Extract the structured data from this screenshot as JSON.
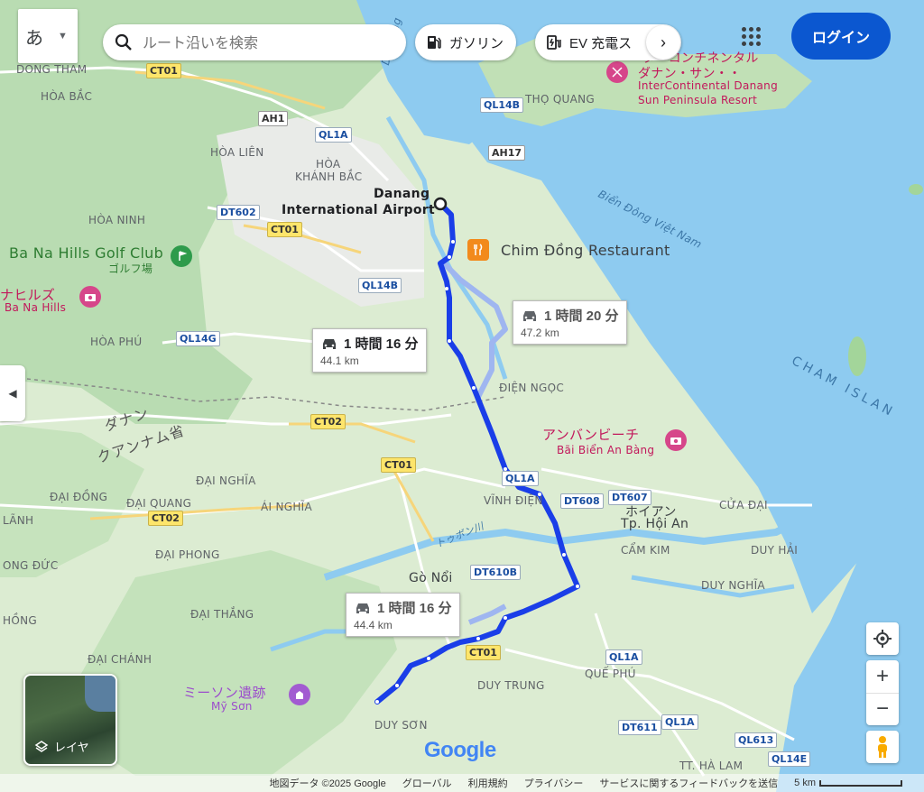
{
  "input_method_label": "あ",
  "search": {
    "placeholder": "ルート沿いを検索"
  },
  "chips": [
    {
      "label": "ガソリン"
    },
    {
      "label": "EV 充電ス"
    }
  ],
  "login_label": "ログイン",
  "places": {
    "origin_line1": "Danang",
    "origin_line2": "International Airport",
    "restaurant": "Chim Đồng Restaurant",
    "golf_name": "Ba Na Hills Golf Club",
    "golf_sub": "ゴルフ場",
    "banahills_jp": "ナヒルズ",
    "banahills_en": "Ba Na Hills",
    "beach_jp": "アンバンビーチ",
    "beach_en": "Bãi Biển An Bàng",
    "resort_jp1": "ターコンチネンタル",
    "resort_jp2": "ダナン・サン・・",
    "resort_en1": "InterContinental Danang",
    "resort_en2": "Sun Peninsula Resort",
    "myson_jp": "ミーソン遺跡",
    "myson_en": "Mỹ Sơn"
  },
  "labels": {
    "dong_tham": "DONG THAM",
    "hoa_bac": "HÒA BẮC",
    "hoa_lien": "HÒA LIÊN",
    "hoa": "HÒA",
    "khanh_bac": "KHÁNH BẮC",
    "hoa_ninh": "HÒA NINH",
    "hoa_phu": "HÒA PHÚ",
    "tho_quang": "THỌ QUANG",
    "dien_ngoc": "ĐIỆN NGỌC",
    "vinh_dien": "VĨNH ĐIỆN",
    "hoi_an_jp": "ホイアン",
    "hoi_an": "Tp. Hội An",
    "cua_dai": "CỬA ĐẠI",
    "cam_kim": "CẨM KIM",
    "duy_hai": "DUY HẢI",
    "duy_nghia": "DUY NGHĨA",
    "dai_nghia": "ĐẠI NGHĨA",
    "dai_dong": "ĐẠI ĐỒNG",
    "dai_quang": "ĐẠI QUANG",
    "ai_nghia": "ÁI NGHĨA",
    "lanh": "LÃNH",
    "dai_phong": "ĐẠI PHONG",
    "ong_duc": "ONG ĐỨC",
    "go_noi": "Gò Nổi",
    "dai_thang": "ĐẠI THẮNG",
    "hong": "HỒNG",
    "dai_chanh": "ĐẠI CHÁNH",
    "duy_trung": "DUY TRUNG",
    "que_phu": "QUẾ PHÚ",
    "duy_son": "DUY SƠN",
    "tt_ha_lam": "TT. HÀ LAM",
    "da_nang_river": "Da Nang",
    "bien_dong": "Biển Đông Việt Nam",
    "cham_islands": "CHAM ISLAN",
    "region1": "ダナン",
    "region2": "クアンナム省",
    "river_jp": "トゥボン川"
  },
  "shields": {
    "ct01": "CT01",
    "ct02": "CT02",
    "ah1": "AH1",
    "ah17": "AH17",
    "ql1a": "QL1A",
    "ql14b": "QL14B",
    "ql14g": "QL14G",
    "ql14e": "QL14E",
    "dt602": "DT602",
    "dt608": "DT608",
    "dt607": "DT607",
    "dt610b": "DT610B",
    "dt611": "DT611",
    "ql613": "QL613"
  },
  "routes": [
    {
      "time": "1 時間 16 分",
      "distance": "44.1 km"
    },
    {
      "time": "1 時間 20 分",
      "distance": "47.2 km"
    },
    {
      "time": "1 時間 16 分",
      "distance": "44.4 km"
    }
  ],
  "layers_label": "レイヤ",
  "google_logo": "Google",
  "footer": {
    "map_data": "地図データ ©2025 Google",
    "global": "グローバル",
    "terms": "利用規約",
    "privacy": "プライバシー",
    "feedback": "サービスに関するフィードバックを送信",
    "scale": "5 km"
  },
  "colors": {
    "route_primary": "#1a3ee8",
    "route_alt": "#9fb6f0",
    "water": "#8ecbf0",
    "land": "#dcecd2",
    "login_button": "#0b57d0"
  }
}
